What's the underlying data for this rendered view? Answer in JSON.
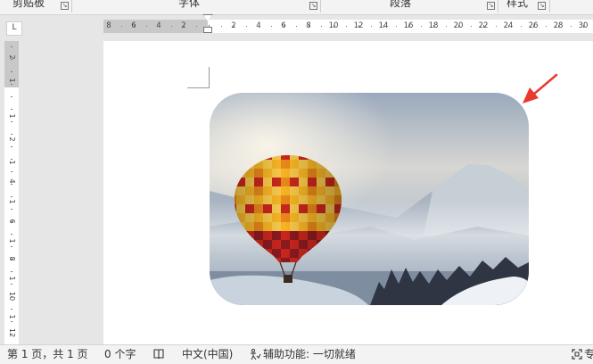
{
  "ribbon": {
    "groups": [
      {
        "label": "剪贴板"
      },
      {
        "label": "字体"
      },
      {
        "label": "段落"
      },
      {
        "label": "样式"
      }
    ]
  },
  "ruler": {
    "corner_glyph": "L",
    "horizontal_ticks": [
      "8",
      "6",
      "4",
      "2",
      "2",
      "4",
      "6",
      "8",
      "10",
      "12",
      "14",
      "16",
      "18",
      "20",
      "22",
      "24",
      "26",
      "28",
      "30"
    ],
    "vertical_ticks": [
      "2",
      "1",
      "1",
      "2",
      "1",
      "4",
      "1",
      "6",
      "1",
      "8",
      "1",
      "10",
      "1",
      "12"
    ]
  },
  "image": {
    "subject": "hot-air balloon over misty mountains",
    "accent_arrow_color": "#e83a30"
  },
  "status": {
    "page": "第 1 页，共 1 页",
    "words": "0 个字",
    "language": "中文(中国)",
    "accessibility": "辅助功能: 一切就绪",
    "right_partial": "专"
  }
}
